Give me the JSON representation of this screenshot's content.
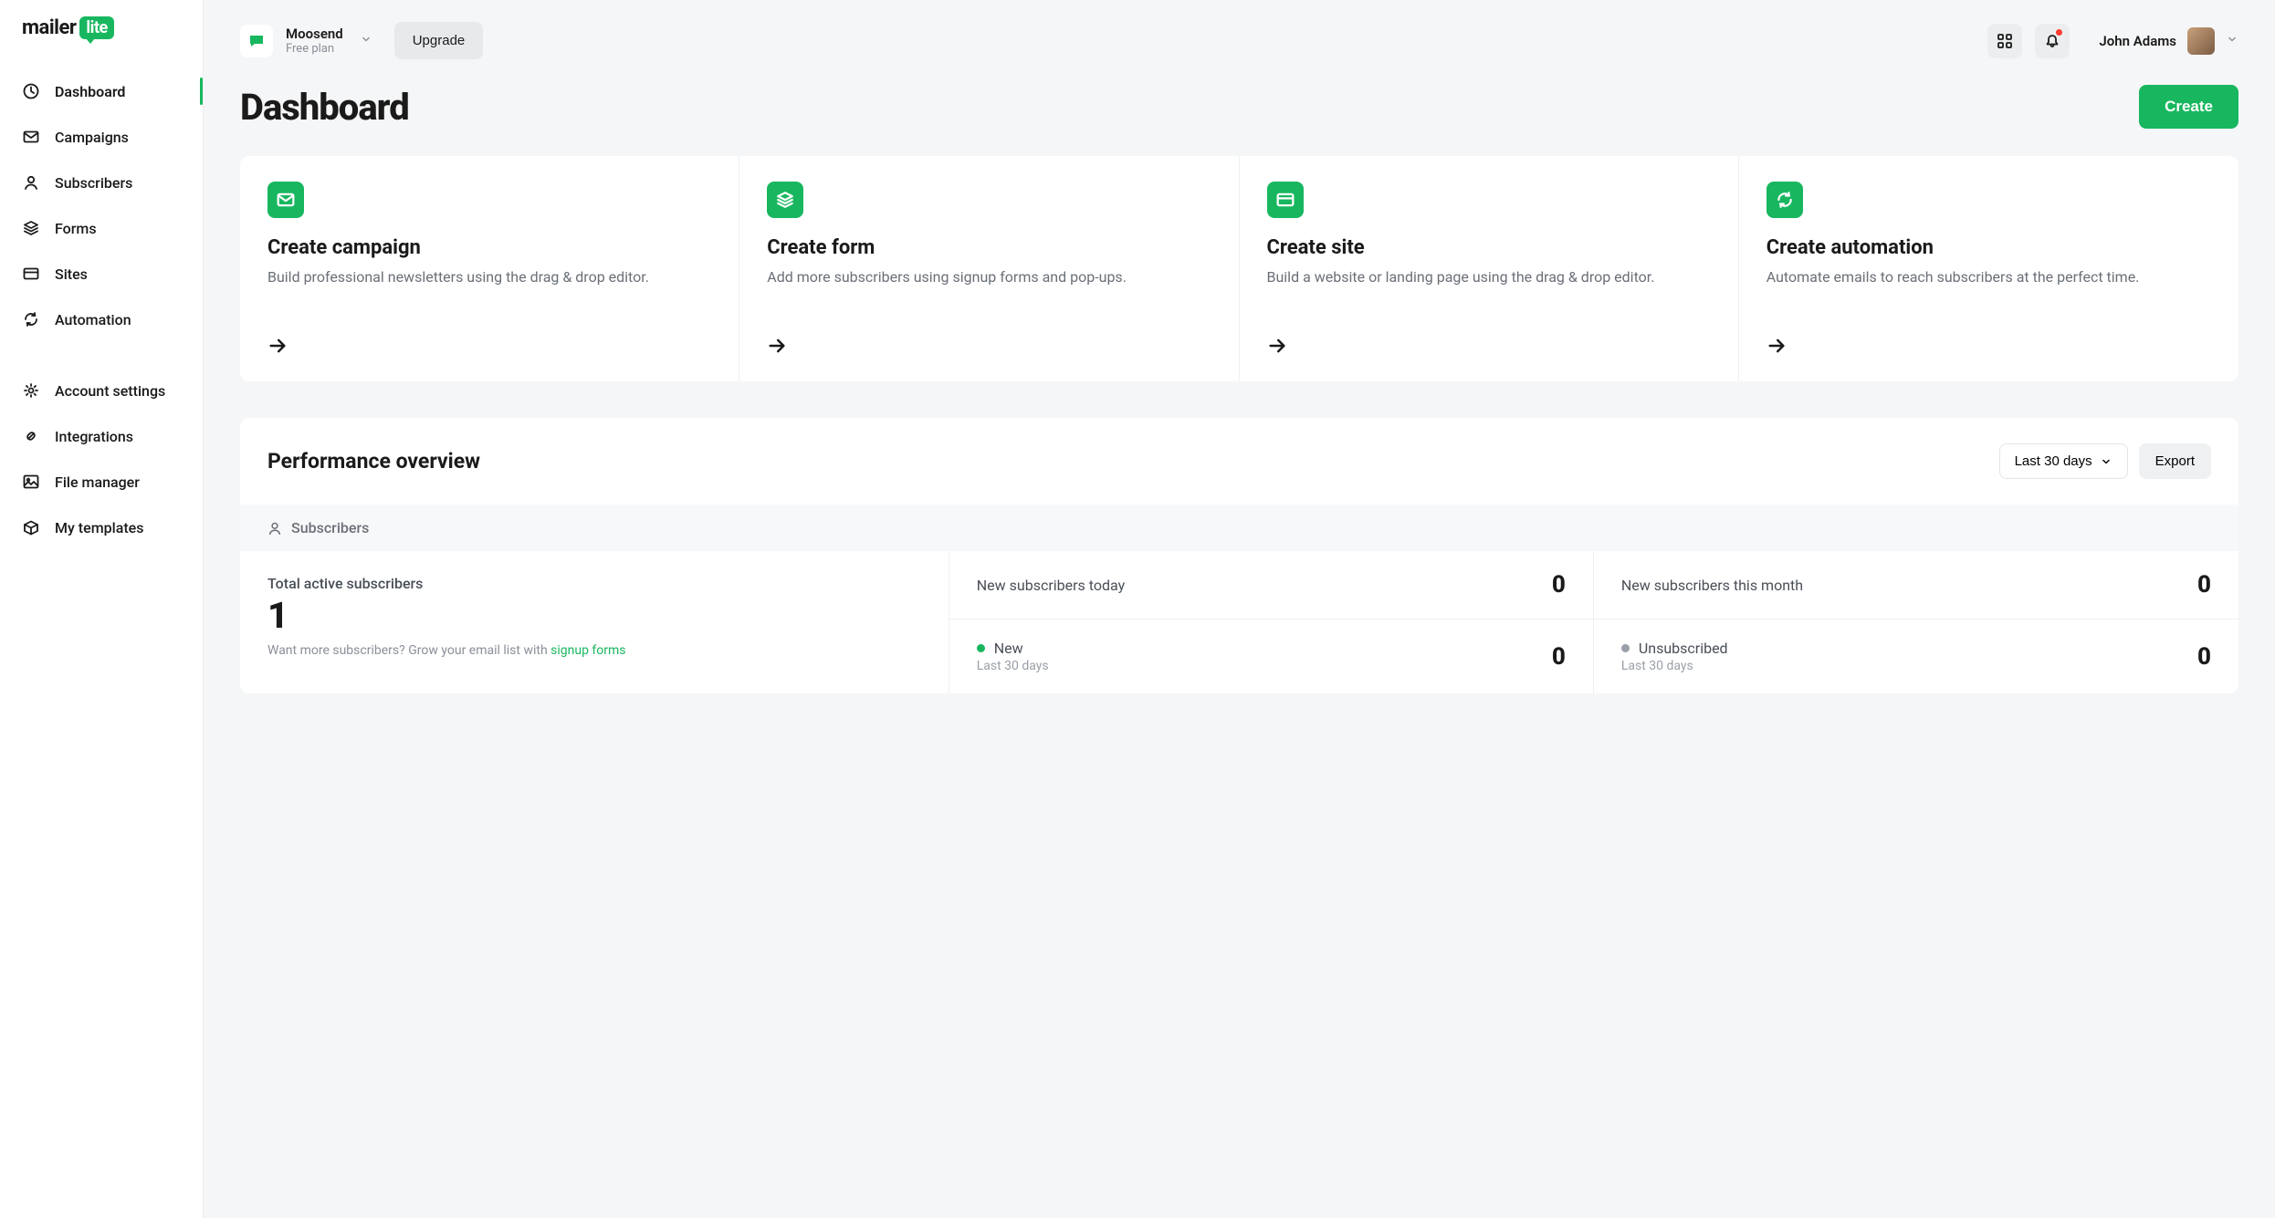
{
  "brand": {
    "name": "mailer",
    "suffix": "lite"
  },
  "sidebar": {
    "primary": [
      {
        "label": "Dashboard",
        "icon": "clock",
        "active": true
      },
      {
        "label": "Campaigns",
        "icon": "mail",
        "active": false
      },
      {
        "label": "Subscribers",
        "icon": "user",
        "active": false
      },
      {
        "label": "Forms",
        "icon": "layers",
        "active": false
      },
      {
        "label": "Sites",
        "icon": "card",
        "active": false
      },
      {
        "label": "Automation",
        "icon": "refresh",
        "active": false
      }
    ],
    "secondary": [
      {
        "label": "Account settings",
        "icon": "gear"
      },
      {
        "label": "Integrations",
        "icon": "link"
      },
      {
        "label": "File manager",
        "icon": "image"
      },
      {
        "label": "My templates",
        "icon": "box"
      }
    ]
  },
  "topbar": {
    "account_name": "Moosend",
    "plan_label": "Free plan",
    "upgrade_label": "Upgrade",
    "user_name": "John Adams"
  },
  "page": {
    "title": "Dashboard",
    "create_label": "Create"
  },
  "cards": [
    {
      "title": "Create campaign",
      "desc": "Build professional newsletters using the drag & drop editor.",
      "icon": "mail"
    },
    {
      "title": "Create form",
      "desc": "Add more subscribers using signup forms and pop-ups.",
      "icon": "layers"
    },
    {
      "title": "Create site",
      "desc": "Build a website or landing page using the drag & drop editor.",
      "icon": "card"
    },
    {
      "title": "Create automation",
      "desc": "Automate emails to reach subscribers at the perfect time.",
      "icon": "refresh"
    }
  ],
  "perf": {
    "title": "Performance overview",
    "range_label": "Last 30 days",
    "export_label": "Export",
    "section_label": "Subscribers",
    "total_label": "Total active subscribers",
    "total_value": "1",
    "hint_prefix": "Want more subscribers? ",
    "hint_text": "Grow your email list with ",
    "hint_link": "signup forms",
    "cells": {
      "new_today_label": "New subscribers today",
      "new_today_value": "0",
      "new_month_label": "New subscribers this month",
      "new_month_value": "0",
      "new_label": "New",
      "new_sub": "Last 30 days",
      "new_value": "0",
      "unsub_label": "Unsubscribed",
      "unsub_sub": "Last 30 days",
      "unsub_value": "0"
    }
  }
}
